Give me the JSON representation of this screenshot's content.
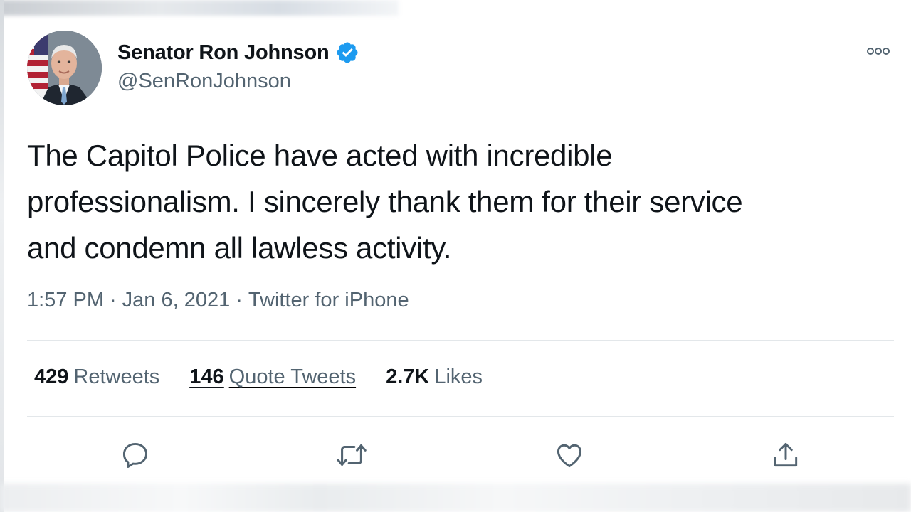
{
  "author": {
    "display_name": "Senator Ron Johnson",
    "handle": "@SenRonJohnson",
    "verified": true,
    "verified_color": "#1d9bf0"
  },
  "tweet": {
    "text_lines": [
      "The Capitol Police have acted with incredible",
      "professionalism. I sincerely thank them for their service",
      "and condemn all lawless activity."
    ],
    "time": "1:57 PM",
    "date": "Jan 6, 2021",
    "source": "Twitter for iPhone",
    "separator": "·"
  },
  "stats": {
    "retweets": {
      "count": "429",
      "label": "Retweets"
    },
    "quotes": {
      "count": "146",
      "label": "Quote Tweets"
    },
    "likes": {
      "count": "2.7K",
      "label": "Likes"
    }
  },
  "actions": [
    {
      "icon": "reply-icon"
    },
    {
      "icon": "retweet-icon"
    },
    {
      "icon": "like-icon"
    },
    {
      "icon": "share-icon"
    }
  ],
  "colors": {
    "text_primary": "#0f1419",
    "text_secondary": "#536471",
    "icon": "#536471",
    "divider": "#e3e7ea"
  }
}
